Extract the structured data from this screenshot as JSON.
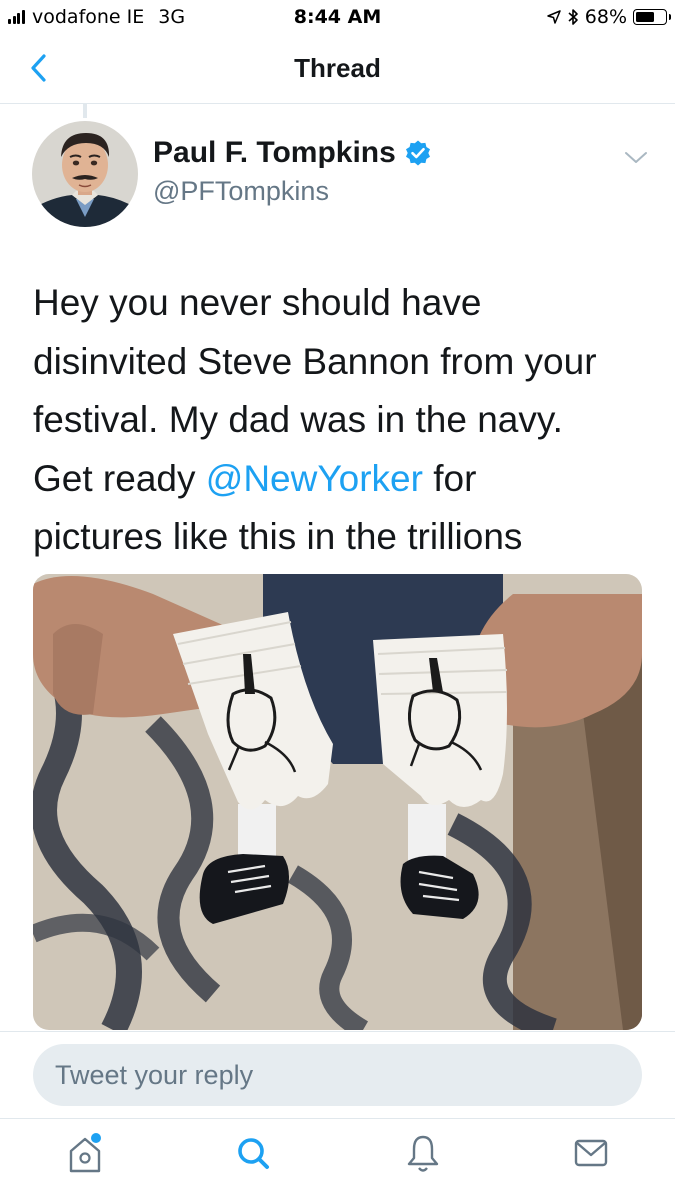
{
  "status_bar": {
    "carrier": "vodafone IE",
    "network": "3G",
    "time": "8:44 AM",
    "battery_percent": "68%",
    "battery_level": 0.68,
    "icons": [
      "signal-bars-icon",
      "location-arrow-icon",
      "bluetooth-icon",
      "battery-icon"
    ]
  },
  "nav": {
    "title": "Thread",
    "back_icon": "chevron-left-icon"
  },
  "tweet": {
    "author_name": "Paul F. Tompkins",
    "author_handle": "@PFTompkins",
    "verified": true,
    "text_lines": [
      {
        "before": "Hey you never should have",
        "mention": "",
        "after": ""
      },
      {
        "before": "disinvited Steve Bannon from your",
        "mention": "",
        "after": ""
      },
      {
        "before": "festival. My dad was in the navy.",
        "mention": "",
        "after": ""
      },
      {
        "before": "Get ready ",
        "mention": "@NewYorker",
        "after": " for"
      },
      {
        "before": "pictures like this in the trillions",
        "mention": "",
        "after": ""
      }
    ],
    "menu_icon": "chevron-down-icon"
  },
  "reply": {
    "placeholder": "Tweet your reply"
  },
  "tabs": [
    {
      "name": "home",
      "icon": "home-icon"
    },
    {
      "name": "search",
      "icon": "search-icon"
    },
    {
      "name": "notifications",
      "icon": "bell-icon"
    },
    {
      "name": "messages",
      "icon": "envelope-icon"
    }
  ],
  "colors": {
    "accent": "#1da1f2",
    "text": "#14171a",
    "secondary_text": "#657786",
    "divider": "#e1e8ed",
    "reply_field": "#e6ecf0"
  }
}
